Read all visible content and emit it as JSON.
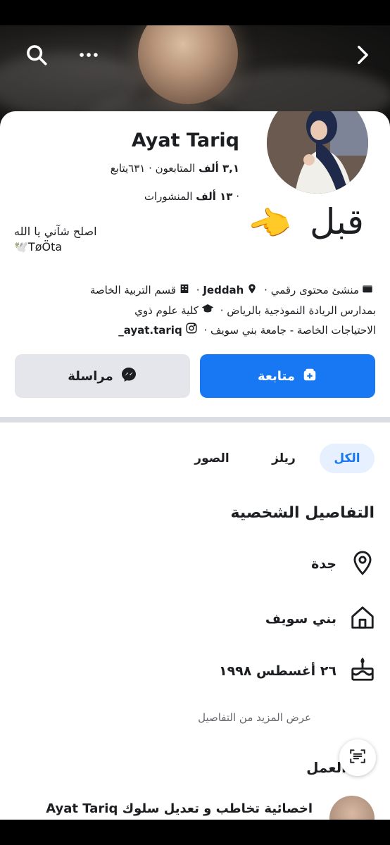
{
  "profile": {
    "name": "Ayat Tariq",
    "followers_line_bold": "٣,١ ألف",
    "followers_line_rest": " المتابعون · ٦٣١يتابع",
    "posts_line_bold": "١٣ ألف",
    "posts_line_rest": " المنشورات",
    "bio_line1": "اصلح شآني يا الله",
    "bio_line2": "TøÖta🕊️",
    "overlay_text": "قبل",
    "overlay_emoji": "👉"
  },
  "intro": {
    "line1_a": "منشئ محتوى رقمي",
    "line1_b": "Jeddah",
    "line1_c": "قسم التربية الخاصة",
    "line2_a": "بمدارس الريادة النموذجية بالرياض",
    "line2_b": "كلية علوم ذوي",
    "line3_a": "الاحتياجات الخاصة - جامعة بني سويف",
    "line3_b": "ayat.tariq_"
  },
  "buttons": {
    "follow_label": "متابعة",
    "message_label": "مراسلة"
  },
  "tabs": {
    "all": "الكل",
    "reels": "ريلز",
    "photos": "الصور"
  },
  "details": {
    "title": "التفاصيل الشخصية",
    "location": "جدة",
    "hometown": "بني سويف",
    "birthday": "٢٦ أغسطس ١٩٩٨",
    "see_more": "عرض المزيد من التفاصيل"
  },
  "work": {
    "title": "العمل",
    "post_text": "اخصائية تخاطب و تعديل سلوك Ayat Tariq"
  },
  "colors": {
    "accent": "#1877f2",
    "secondary_button": "#e4e6eb",
    "tab_active_bg": "#e7f0fe"
  }
}
